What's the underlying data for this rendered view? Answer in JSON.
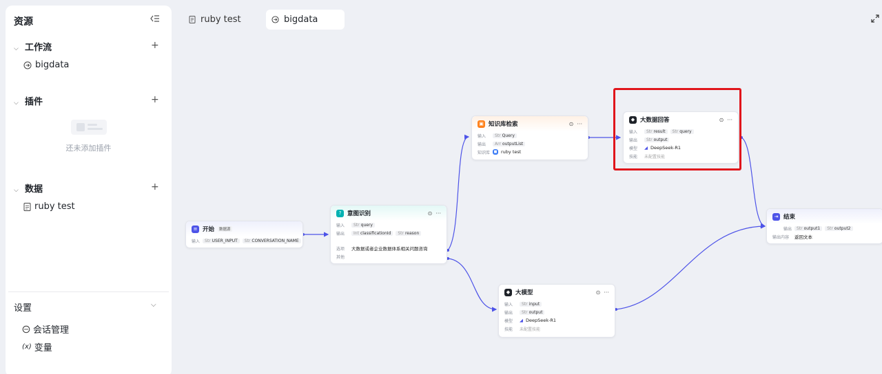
{
  "sidebar": {
    "title": "资源",
    "sections": {
      "workflow": {
        "label": "工作流",
        "items": [
          "bigdata"
        ]
      },
      "plugins": {
        "label": "插件",
        "empty_text": "还未添加插件"
      },
      "data": {
        "label": "数据",
        "items": [
          "ruby test"
        ]
      }
    },
    "settings": {
      "label": "设置",
      "items": [
        "会话管理",
        "变量"
      ]
    }
  },
  "tabs": [
    {
      "label": "ruby test",
      "icon": "document-icon"
    },
    {
      "label": "bigdata",
      "icon": "workflow-icon"
    }
  ],
  "nodes": {
    "start": {
      "title": "开始",
      "badge": "数据源",
      "input_label": "输入",
      "inputs": [
        {
          "type": "Str",
          "name": "USER_INPUT"
        },
        {
          "type": "Str",
          "name": "CONVERSATION_NAME"
        }
      ]
    },
    "intent": {
      "title": "意图识别",
      "input_label": "输入",
      "input": {
        "type": "Str",
        "name": "query"
      },
      "output_label": "输出",
      "outputs": [
        {
          "type": "Int",
          "name": "classificationId"
        },
        {
          "type": "Str",
          "name": "reason"
        }
      ],
      "option_label": "选项",
      "option_text": "大数据或者企业数据体系相关问题咨询",
      "other_label": "其他"
    },
    "knowledge": {
      "title": "知识库检索",
      "input_label": "输入",
      "input": {
        "type": "Str",
        "name": "Query"
      },
      "output_label": "输出",
      "output": {
        "type": "Arr",
        "name": "outputList"
      },
      "kb_label": "知识库",
      "kb_value": "ruby test"
    },
    "bigdata_answer": {
      "title": "大数据回答",
      "input_label": "输入",
      "inputs": [
        {
          "type": "Str",
          "name": "result"
        },
        {
          "type": "Str",
          "name": "query"
        }
      ],
      "output_label": "输出",
      "output": {
        "type": "Str",
        "name": "output"
      },
      "model_label": "模型",
      "model_value": "DeepSeek-R1",
      "skill_label": "技能",
      "skill_value": "未配置技能"
    },
    "llm": {
      "title": "大模型",
      "input_label": "输入",
      "input": {
        "type": "Str",
        "name": "input"
      },
      "output_label": "输出",
      "output": {
        "type": "Str",
        "name": "output"
      },
      "model_label": "模型",
      "model_value": "DeepSeek-R1",
      "skill_label": "技能",
      "skill_value": "未配置技能"
    },
    "end": {
      "title": "结束",
      "output_label": "输出",
      "outputs": [
        {
          "type": "Str",
          "name": "output1"
        },
        {
          "type": "Str",
          "name": "output2"
        }
      ],
      "mode_label": "输出内容",
      "mode_value": "返回文本"
    }
  },
  "colors": {
    "start": "#4d53e8",
    "intent": "#00b2b2",
    "knowledge": "#ff811a",
    "llm": "#1f2329",
    "end": "#4d53e8",
    "edge": "#4d53e8",
    "highlight": "#e0151b"
  }
}
